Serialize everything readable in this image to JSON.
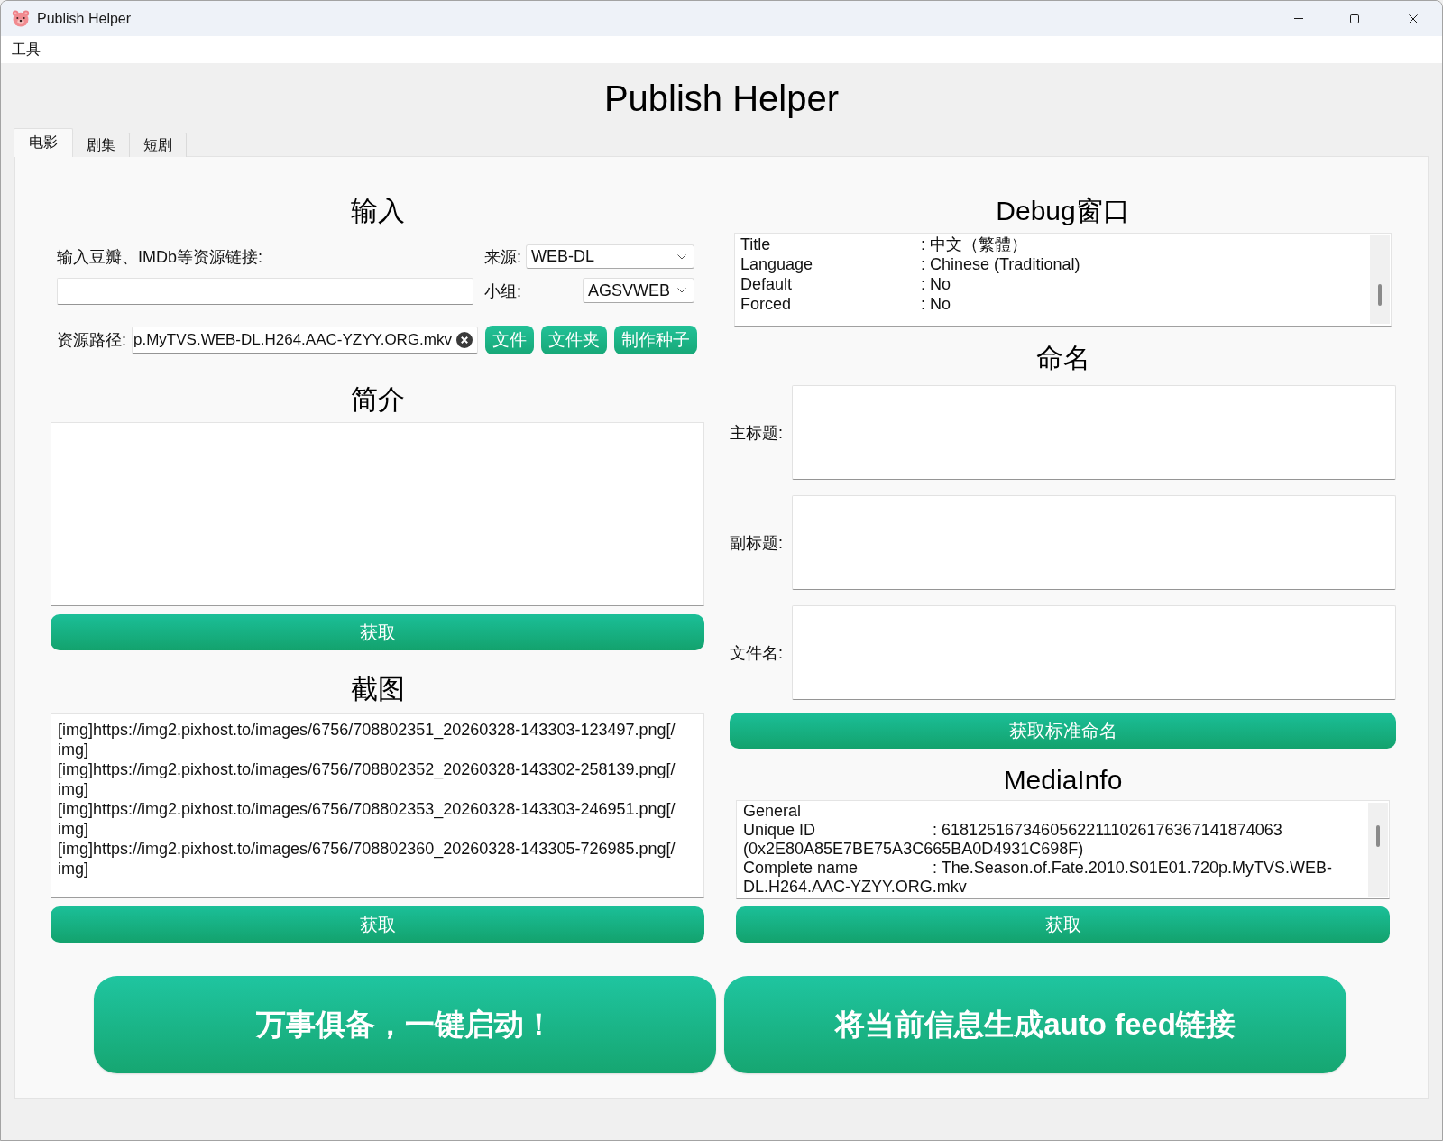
{
  "window": {
    "title": "Publish Helper"
  },
  "menu": [
    {
      "label": "工具"
    }
  ],
  "app_title": "Publish Helper",
  "tabs": [
    {
      "label": "电影",
      "selected": true
    },
    {
      "label": "剧集",
      "selected": false
    },
    {
      "label": "短剧",
      "selected": false
    }
  ],
  "input_section": {
    "heading": "输入",
    "link_label": "输入豆瓣、IMDb等资源链接:",
    "source": {
      "label": "来源:",
      "value": "WEB-DL"
    },
    "group": {
      "label": "小组:",
      "value": "AGSVWEB"
    },
    "path": {
      "label": "资源路径:",
      "value": "p.MyTVS.WEB-DL.H264.AAC-YZYY.ORG.mkv"
    },
    "buttons": [
      "文件",
      "文件夹",
      "制作种子"
    ]
  },
  "summary": {
    "heading": "简介",
    "button": "获取"
  },
  "screenshots": {
    "heading": "截图",
    "lines": [
      "[img]https://img2.pixhost.to/images/6756/708802351_20260328-143303-123497.png[/",
      "img]",
      "[img]https://img2.pixhost.to/images/6756/708802352_20260328-143302-258139.png[/",
      "img]",
      "[img]https://img2.pixhost.to/images/6756/708802353_20260328-143303-246951.png[/",
      "img]",
      "[img]https://img2.pixhost.to/images/6756/708802360_20260328-143305-726985.png[/",
      "img]"
    ],
    "button": "获取"
  },
  "debug": {
    "heading": "Debug窗口",
    "lines": [
      {
        "key": "Title",
        "value": ": 中文（繁體）"
      },
      {
        "key": "Language",
        "value": ": Chinese (Traditional)"
      },
      {
        "key": "Default",
        "value": ": No"
      },
      {
        "key": "Forced",
        "value": ": No"
      }
    ]
  },
  "naming": {
    "heading": "命名",
    "fields": [
      {
        "label": "主标题:"
      },
      {
        "label": "副标题:"
      },
      {
        "label": "文件名:"
      }
    ],
    "button": "获取标准命名"
  },
  "mediainfo": {
    "heading": "MediaInfo",
    "lines": [
      {
        "text": "General"
      },
      {
        "key": "Unique ID",
        "value": ": 61812516734605622111026176367141874063"
      },
      {
        "text": "(0x2E80A85E7BE75A3C665BA0D4931C698F)"
      },
      {
        "key": "Complete name",
        "value": ": The.Season.of.Fate.2010.S01E01.720p.MyTVS.WEB-"
      },
      {
        "text": "DL.H264.AAC-YZYY.ORG.mkv"
      }
    ],
    "button": "获取"
  },
  "actions": [
    "万事俱备，一键启动！",
    "将当前信息生成auto feed链接"
  ]
}
